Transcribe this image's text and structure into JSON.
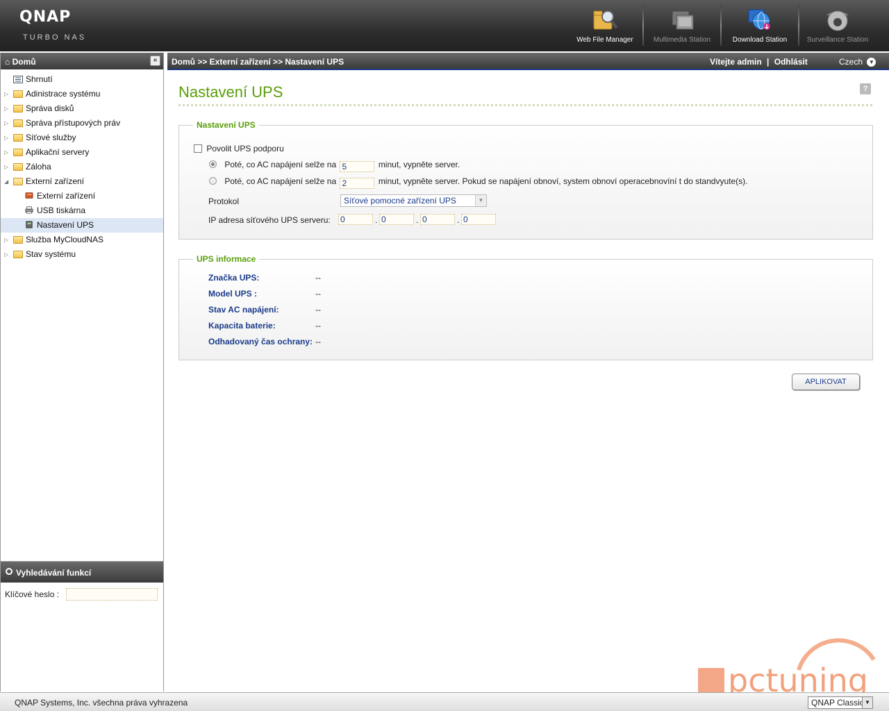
{
  "brand": {
    "logo": "QNAP",
    "subtitle": "TURBO NAS"
  },
  "apps": [
    {
      "label": "Web File Manager",
      "icon": "web-file-manager-icon"
    },
    {
      "label": "Multimedia Station",
      "icon": "multimedia-station-icon"
    },
    {
      "label": "Download Station",
      "icon": "download-station-icon"
    },
    {
      "label": "Surveillance Station",
      "icon": "surveillance-station-icon"
    }
  ],
  "sidebar": {
    "title": "Domů",
    "items": [
      {
        "label": "Shrnutí"
      },
      {
        "label": "Adinistrace systému"
      },
      {
        "label": "Správa disků"
      },
      {
        "label": "Správa přístupových práv"
      },
      {
        "label": "Síťové služby"
      },
      {
        "label": "Aplikační servery"
      },
      {
        "label": "Záloha"
      },
      {
        "label": "Externí zařízení"
      },
      {
        "label": "Externí zařízení"
      },
      {
        "label": "USB tiskárna"
      },
      {
        "label": "Nastavení UPS"
      },
      {
        "label": "Služba MyCloudNAS"
      },
      {
        "label": "Stav systému"
      }
    ]
  },
  "search": {
    "title": "Vyhledávání funkcí",
    "label": "Klíčové heslo :",
    "value": ""
  },
  "breadcrumb": "Domů >> Externí zařízení >> Nastavení UPS",
  "user": {
    "welcome": "Vítejte admin",
    "sep": "|",
    "logout": "Odhlásit",
    "language": "Czech"
  },
  "page": {
    "title": "Nastavení UPS",
    "help": "?"
  },
  "ups_settings": {
    "legend": "Nastavení UPS",
    "enable_label": "Povolit UPS podporu",
    "enabled": false,
    "opt1_prefix": "Poté, co AC napájení selže na",
    "opt1_value": "5",
    "opt1_suffix": "minut, vypněte server.",
    "opt2_prefix": "Poté, co AC napájení selže na",
    "opt2_value": "2",
    "opt2_suffix": "minut, vypněte server. Pokud se napájení obnoví, system obnoví operacebnovíní t do standvyute(s).",
    "protocol_label": "Protokol",
    "protocol_value": "Síťové pomocné zařízení UPS",
    "ip_label": "IP adresa síťového UPS serveru:",
    "ip": [
      "0",
      "0",
      "0",
      "0"
    ],
    "ip_dot": "."
  },
  "ups_info": {
    "legend": "UPS informace",
    "rows": [
      {
        "label": "Značka UPS:",
        "value": "--"
      },
      {
        "label": "Model UPS :",
        "value": "--"
      },
      {
        "label": "Stav AC napájení:",
        "value": "--"
      },
      {
        "label": "Kapacita baterie:",
        "value": "--"
      },
      {
        "label": "Odhadovaný čas ochrany:",
        "value": "--"
      }
    ]
  },
  "apply_label": "APLIKOVAT",
  "footer": {
    "copyright": "QNAP Systems, Inc. všechna práva vyhrazena",
    "theme": "QNAP Classic"
  },
  "watermark": "pctuning",
  "colors": {
    "accent_green": "#5a9e0a",
    "label_blue": "#1a3a8a",
    "header_dark": "#3b3b3b",
    "watermark": "#f08a5d"
  }
}
